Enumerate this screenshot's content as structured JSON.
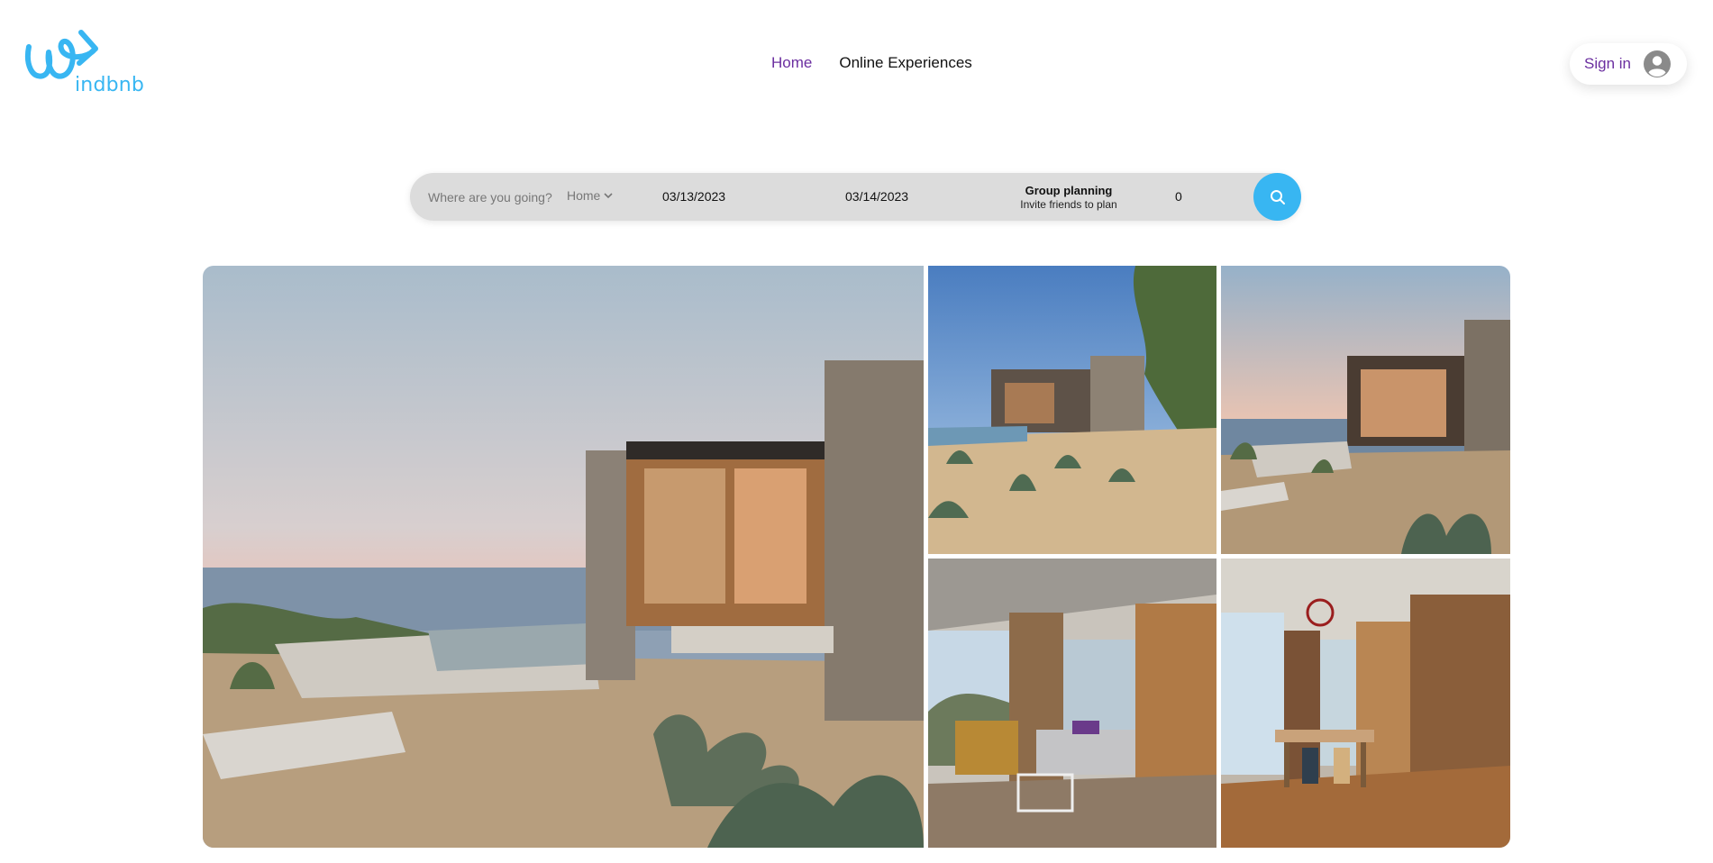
{
  "brand": {
    "logo_text": "indbnb",
    "accent_color": "#38b6f2",
    "link_color": "#6b2fa0"
  },
  "nav": {
    "home": "Home",
    "online_experiences": "Online Experiences"
  },
  "account": {
    "sign_in_label": "Sign in",
    "avatar_icon": "user-circle-icon"
  },
  "search": {
    "destination_placeholder": "Where are you going?",
    "type_selected": "Home",
    "checkin": "03/13/2023",
    "checkout": "03/14/2023",
    "group_title": "Group planning",
    "group_subtitle": "Invite friends to plan",
    "guests": "0",
    "search_icon": "search-icon"
  },
  "gallery": {
    "photos": [
      "modern house exterior at sunset with infinity pool",
      "house exterior with desert garden",
      "house exterior with pool and ocean view",
      "living room with mountain view",
      "dining room with wood paneling"
    ]
  }
}
